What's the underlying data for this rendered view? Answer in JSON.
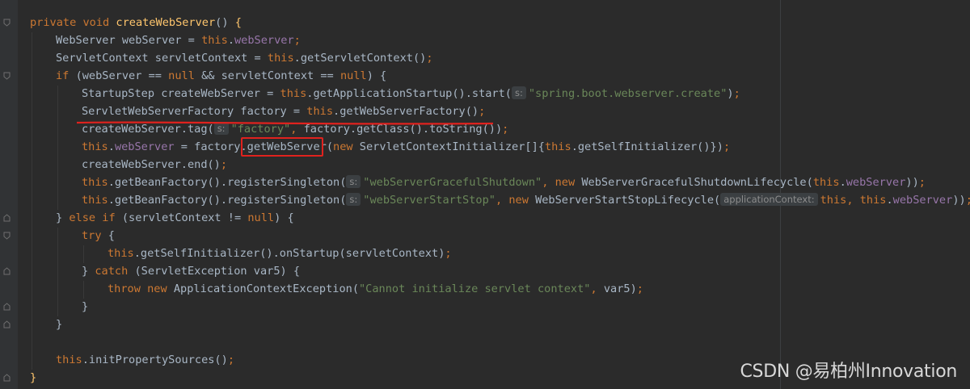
{
  "editor": {
    "lines": [
      {
        "indent": 0,
        "parts": [
          [
            "kw",
            "private void "
          ],
          [
            "fn",
            "createWebServer"
          ],
          [
            "",
            "() "
          ],
          [
            "brace",
            "{"
          ]
        ]
      },
      {
        "indent": 1,
        "parts": [
          [
            "",
            "WebServer webServer = "
          ],
          [
            "kw",
            "this"
          ],
          [
            "",
            "."
          ],
          [
            "fld",
            "webServer"
          ],
          [
            "kw",
            ";"
          ]
        ]
      },
      {
        "indent": 1,
        "parts": [
          [
            "",
            "ServletContext servletContext = "
          ],
          [
            "kw",
            "this"
          ],
          [
            "",
            ".getServletContext()"
          ],
          [
            "kw",
            ";"
          ]
        ]
      },
      {
        "indent": 1,
        "parts": [
          [
            "kw",
            "if "
          ],
          [
            "",
            "(webServer == "
          ],
          [
            "kw",
            "null "
          ],
          [
            "",
            "&& servletContext == "
          ],
          [
            "kw",
            "null"
          ],
          [
            "",
            ") {"
          ]
        ]
      },
      {
        "indent": 2,
        "parts": [
          [
            "",
            "StartupStep createWebServer = "
          ],
          [
            "kw",
            "this"
          ],
          [
            "",
            ".getApplicationStartup().start("
          ],
          [
            "hint",
            "s:"
          ],
          [
            "str",
            "\"spring.boot.webserver.create\""
          ],
          [
            "",
            ")"
          ],
          [
            "kw",
            ";"
          ]
        ]
      },
      {
        "indent": 2,
        "parts": [
          [
            "",
            "ServletWebServerFactory factory = "
          ],
          [
            "kw",
            "this"
          ],
          [
            "",
            ".getWebServerFactory()"
          ],
          [
            "kw",
            ";"
          ]
        ]
      },
      {
        "indent": 2,
        "parts": [
          [
            "",
            "createWebServer.tag("
          ],
          [
            "hint",
            "s:"
          ],
          [
            "str",
            "\"factory\""
          ],
          [
            "kw",
            ", "
          ],
          [
            "",
            "factory.getClass().toString())"
          ],
          [
            "kw",
            ";"
          ]
        ]
      },
      {
        "indent": 2,
        "parts": [
          [
            "kw",
            "this"
          ],
          [
            "",
            "."
          ],
          [
            "fld",
            "webServer"
          ],
          [
            "",
            " = factory.getWebServer("
          ],
          [
            "kw",
            "new "
          ],
          [
            "",
            "ServletContextInitializer[]{"
          ],
          [
            "kw",
            "this"
          ],
          [
            "",
            ".getSelfInitializer()})"
          ],
          [
            "kw",
            ";"
          ]
        ]
      },
      {
        "indent": 2,
        "parts": [
          [
            "",
            "createWebServer.end()"
          ],
          [
            "kw",
            ";"
          ]
        ]
      },
      {
        "indent": 2,
        "parts": [
          [
            "kw",
            "this"
          ],
          [
            "",
            ".getBeanFactory().registerSingleton("
          ],
          [
            "hint",
            "s:"
          ],
          [
            "str",
            "\"webServerGracefulShutdown\""
          ],
          [
            "kw",
            ", new "
          ],
          [
            "",
            "WebServerGracefulShutdownLifecycle("
          ],
          [
            "kw",
            "this"
          ],
          [
            "",
            "."
          ],
          [
            "fld",
            "webServer"
          ],
          [
            "",
            "))"
          ],
          [
            "kw",
            ";"
          ]
        ]
      },
      {
        "indent": 2,
        "parts": [
          [
            "kw",
            "this"
          ],
          [
            "",
            ".getBeanFactory().registerSingleton("
          ],
          [
            "hint",
            "s:"
          ],
          [
            "str",
            "\"webServerStartStop\""
          ],
          [
            "kw",
            ", new "
          ],
          [
            "",
            "WebServerStartStopLifecycle("
          ],
          [
            "hint",
            "applicationContext:"
          ],
          [
            "kw",
            "this"
          ],
          [
            "kw",
            ", this"
          ],
          [
            "",
            "."
          ],
          [
            "fld",
            "webServer"
          ],
          [
            "",
            "))"
          ],
          [
            "kw",
            ";"
          ]
        ]
      },
      {
        "indent": 1,
        "parts": [
          [
            "",
            "} "
          ],
          [
            "kw",
            "else if "
          ],
          [
            "",
            "(servletContext != "
          ],
          [
            "kw",
            "null"
          ],
          [
            "",
            ") {"
          ]
        ]
      },
      {
        "indent": 2,
        "parts": [
          [
            "kw",
            "try "
          ],
          [
            "",
            "{"
          ]
        ]
      },
      {
        "indent": 3,
        "parts": [
          [
            "kw",
            "this"
          ],
          [
            "",
            ".getSelfInitializer().onStartup(servletContext)"
          ],
          [
            "kw",
            ";"
          ]
        ]
      },
      {
        "indent": 2,
        "parts": [
          [
            "",
            "} "
          ],
          [
            "kw",
            "catch "
          ],
          [
            "",
            "(ServletException var5) {"
          ]
        ]
      },
      {
        "indent": 3,
        "parts": [
          [
            "kw",
            "throw new "
          ],
          [
            "",
            "ApplicationContextException("
          ],
          [
            "str",
            "\"Cannot initialize servlet context\""
          ],
          [
            "kw",
            ", "
          ],
          [
            "",
            "var5)"
          ],
          [
            "kw",
            ";"
          ]
        ]
      },
      {
        "indent": 2,
        "parts": [
          [
            "",
            "}"
          ]
        ]
      },
      {
        "indent": 1,
        "parts": [
          [
            "",
            "}"
          ]
        ]
      },
      {
        "indent": 0,
        "parts": []
      },
      {
        "indent": 1,
        "parts": [
          [
            "kw",
            "this"
          ],
          [
            "",
            ".initPropertySources()"
          ],
          [
            "kw",
            ";"
          ]
        ]
      },
      {
        "indent": 0,
        "parts": [
          [
            "brace",
            "}"
          ]
        ]
      }
    ]
  },
  "watermark": "CSDN @易柏州Innovation",
  "colors": {
    "keyword": "#cc7832",
    "method": "#ffc66d",
    "field": "#9876aa",
    "string": "#6a8759",
    "text": "#a9b7c6",
    "annotation": "#e0221e"
  }
}
